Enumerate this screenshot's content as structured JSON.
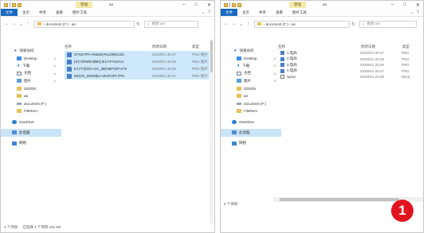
{
  "left": {
    "manage_tab": "管理",
    "title": "aa",
    "tabs": [
      "文件",
      "主页",
      "共享",
      "查看",
      "图片工具"
    ],
    "path": "›  document (F:)  ›  aa",
    "search": "搜索\"aa\"",
    "column_name": "名称",
    "column_date": "修改日期",
    "column_type": "类型",
    "sidebar": [
      {
        "label": "快速访问",
        "icon": "star-icon"
      },
      {
        "label": "Desktop",
        "icon": "desktop-icon"
      },
      {
        "label": "下载",
        "icon": "download-icon"
      },
      {
        "label": "文档",
        "icon": "document-icon"
      },
      {
        "label": "图片",
        "icon": "picture-icon"
      },
      {
        "label": "202005",
        "icon": "folder-icon"
      },
      {
        "label": "aa",
        "icon": "folder-icon"
      },
      {
        "label": "document (F:)",
        "icon": "drive-icon"
      },
      {
        "label": "FileRecv",
        "icon": "folder-icon"
      },
      {
        "label": "OneDrive",
        "icon": "cloud-icon"
      },
      {
        "label": "此电脑",
        "icon": "computer-icon"
      },
      {
        "label": "网络",
        "icon": "network-icon"
      }
    ],
    "files": [
      {
        "name": "37%E7FH~R&6D(I%LD8WU23",
        "date": "2020/5/1 20:47",
        "type": "PNG 图片"
      },
      {
        "name": "{K(Y0RM5V$9K{JKCYF%IUGA",
        "date": "2020/5/1 20:46",
        "type": "PNG 图片"
      },
      {
        "name": "E1YT@G5~GX_3B(N5P@F%TS",
        "date": "2020/5/1 20:46",
        "type": "PNG 图片"
      },
      {
        "name": "MG0O_DMW$U~2RJF3FC7P8",
        "date": "2020/5/1 20:47",
        "type": "PNG 图片"
      }
    ],
    "status_count": "4 个项目",
    "status_selected": "已选择 4 个项目  242 KB"
  },
  "right": {
    "manage_tab": "管理",
    "title": "aa",
    "tabs": [
      "文件",
      "主页",
      "共享",
      "查看",
      "图片工具"
    ],
    "path": "›  document (F:)  ›  aa",
    "search": "搜索\"aa\"",
    "column_name": "名称",
    "column_date": "修改日期",
    "column_type": "类型",
    "sidebar": [
      {
        "label": "快速访问",
        "icon": "star-icon"
      },
      {
        "label": "Desktop",
        "icon": "desktop-icon"
      },
      {
        "label": "下载",
        "icon": "download-icon"
      },
      {
        "label": "文档",
        "icon": "document-icon"
      },
      {
        "label": "图片",
        "icon": "picture-icon"
      },
      {
        "label": "202005",
        "icon": "folder-icon"
      },
      {
        "label": "aa",
        "icon": "folder-icon"
      },
      {
        "label": "document (F:)",
        "icon": "drive-icon"
      },
      {
        "label": "FileRecv",
        "icon": "folder-icon"
      },
      {
        "label": "OneDrive",
        "icon": "cloud-icon"
      },
      {
        "label": "此电脑",
        "icon": "computer-icon"
      },
      {
        "label": "网络",
        "icon": "network-icon"
      }
    ],
    "files": [
      {
        "name": "1.电商",
        "date": "2020/5/1 20:47",
        "type": "PNG"
      },
      {
        "name": "2.电商",
        "date": "2020/5/1 20:46",
        "type": "PNG"
      },
      {
        "name": "3.电商",
        "date": "2020/5/1 20:46",
        "type": "PNG"
      },
      {
        "name": "4.电商",
        "date": "2020/5/1 20:47",
        "type": "PNG"
      },
      {
        "name": "1pow",
        "date": "2020/5/1 23:08",
        "type": "Wind"
      }
    ],
    "status_count": "5 个项目"
  },
  "callout": "1",
  "colors": {
    "selection": "#cde8fa",
    "file_tab": "#1a6ac0",
    "manage_tab": "#f4e9a9",
    "callout": "#e0141e"
  }
}
